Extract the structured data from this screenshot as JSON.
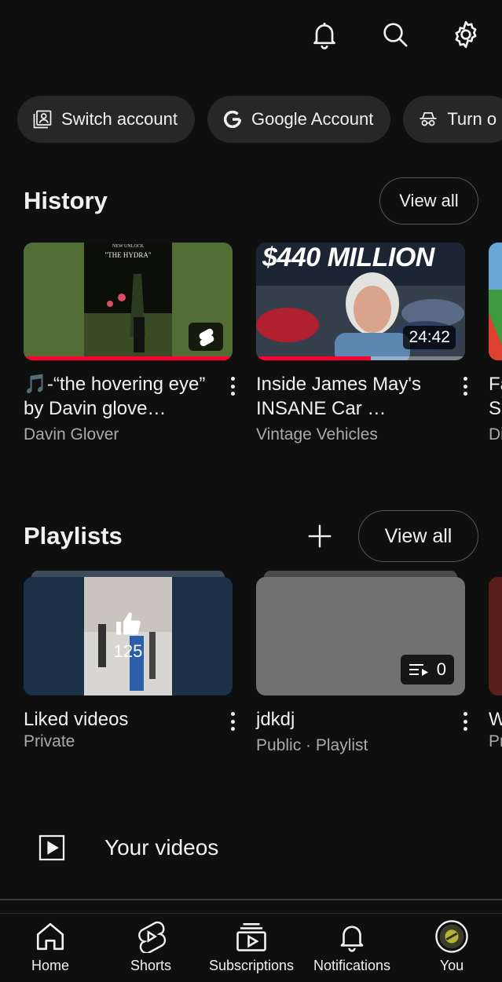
{
  "header": {
    "icons": [
      "notifications-bell-icon",
      "search-icon",
      "settings-gear-icon"
    ]
  },
  "chips": [
    {
      "label": "Switch account",
      "icon": "switch-account-icon"
    },
    {
      "label": "Google Account",
      "icon": "google-g-icon"
    },
    {
      "label": "Turn o",
      "icon": "incognito-icon"
    }
  ],
  "history": {
    "title": "History",
    "view_all": "View all",
    "items": [
      {
        "title": "🎵-“the hovering eye” by Davin glove…",
        "channel": "Davin Glover",
        "thumb_text_small": "NEW UNLOCK",
        "thumb_text": "\"THE HYDRA\"",
        "badge": "shorts-icon",
        "progress": 1.0
      },
      {
        "title": "Inside James May's INSANE Car …",
        "channel": "Vintage Vehicles",
        "thumb_text": "$440 MILLION",
        "duration": "24:42",
        "progress": 0.55
      },
      {
        "title": "Fa Sc",
        "channel": "Di"
      }
    ]
  },
  "playlists": {
    "title": "Playlists",
    "view_all": "View all",
    "items": [
      {
        "title": "Liked videos",
        "meta": "Private",
        "count": "125",
        "icon": "thumbs-up-icon"
      },
      {
        "title": "jdkdj",
        "meta": "Public · Playlist",
        "count": "0",
        "icon": "playlist-icon"
      },
      {
        "title": "W",
        "meta": "Pr"
      }
    ]
  },
  "your_videos": {
    "label": "Your videos"
  },
  "bottom_nav": [
    {
      "label": "Home",
      "icon": "home-icon"
    },
    {
      "label": "Shorts",
      "icon": "shorts-icon"
    },
    {
      "label": "Subscriptions",
      "icon": "subscriptions-icon"
    },
    {
      "label": "Notifications",
      "icon": "notifications-icon"
    },
    {
      "label": "You",
      "icon": "avatar"
    }
  ],
  "colors": {
    "background": "#0f0f0f",
    "chip": "#272727",
    "accent_red": "#ff0033",
    "secondary_text": "#aaaaaa"
  }
}
